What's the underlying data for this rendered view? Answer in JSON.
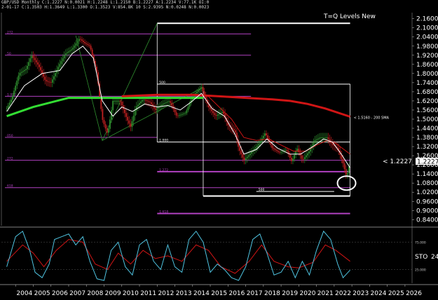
{
  "header": {
    "line1": "GBP/USD Monthly  C:1.2227  N:0.0021  H:1.2248  L:1.2150  B:1.2227  A:1.2234  V:77.1K  OI:0",
    "line2": "2-01-17  C:1.3503  H:1.3649  L:1.3300  O:1.3523  V:854.8K  10  S:2.9395  N:0.0248  N:0.0023"
  },
  "chart_data": [
    {
      "type": "line",
      "title": "T=Q Levels New",
      "x_ticks": [
        "2004",
        "2005",
        "2006",
        "2007",
        "2008",
        "2009",
        "2010",
        "2011",
        "2012",
        "2013",
        "2014",
        "2015",
        "2016",
        "2017",
        "2018",
        "2019",
        "2020",
        "2021",
        "2022",
        "2023",
        "2024",
        "2025",
        "2026"
      ],
      "y_ticks": [
        "2.1600",
        "2.1000",
        "2.0400",
        "1.9800",
        "1.9200",
        "1.8600",
        "1.8000",
        "1.7400",
        "1.6800",
        "1.6200",
        "1.5600",
        "1.5000",
        "1.4400",
        "1.3800",
        "1.3200",
        "1.2600",
        "1.2000",
        "1.1400",
        "1.0800",
        "1.0200",
        "0.9600",
        "0.9000",
        "0.8400"
      ],
      "ylim": [
        0.8,
        2.2
      ],
      "price_label": "1.2227",
      "price_marker": "< 1.2227",
      "price": 1.2227,
      "colors": {
        "up": "#2f8f2f",
        "down": "#c02020",
        "sma200": "#d01515",
        "sma40": "#33dd33",
        "fast": "#ffffff",
        "slow": "#d01515",
        "fib": "#b040c0",
        "level": "#ffffff"
      },
      "sma200_label": "< 1.5160 - 200 SMA",
      "levels": [
        {
          "y": 2.13,
          "x0": 2012.0,
          "x1": 2022.9,
          "label": "",
          "color": "#ffffff",
          "w": 2
        },
        {
          "y": 2.06,
          "x0": 2003.4,
          "x1": 2017.3,
          "label": "272",
          "color": "#b040c0",
          "w": 1
        },
        {
          "y": 1.92,
          "x0": 2003.4,
          "x1": 2017.3,
          "label": "50",
          "color": "#b040c0",
          "w": 1
        },
        {
          "y": 1.73,
          "x0": 2012.0,
          "x1": 2022.9,
          "label": "500",
          "color": "#ffffff",
          "w": 1
        },
        {
          "y": 1.65,
          "x0": 2003.4,
          "x1": 2017.3,
          "label": "1.000",
          "color": "#b040c0",
          "w": 1
        },
        {
          "y": 1.38,
          "x0": 2003.4,
          "x1": 2012.0,
          "label": "050",
          "color": "#b040c0",
          "w": 1
        },
        {
          "y": 1.35,
          "x0": 2012.0,
          "x1": 2022.9,
          "label": "1.000",
          "color": "#ffffff",
          "w": 1
        },
        {
          "y": 1.23,
          "x0": 2003.4,
          "x1": 2022.9,
          "label": "272",
          "color": "#b040c0",
          "w": 1
        },
        {
          "y": 1.155,
          "x0": 2012.0,
          "x1": 2022.9,
          "label": "1.272",
          "color": "#b040c0",
          "w": 2
        },
        {
          "y": 1.05,
          "x0": 2003.4,
          "x1": 2022.9,
          "label": "618",
          "color": "#b040c0",
          "w": 1
        },
        {
          "y": 1.025,
          "x0": 2017.6,
          "x1": 2022.0,
          "label": "500",
          "color": "#ffffff",
          "w": 1
        },
        {
          "y": 0.995,
          "x0": 2014.6,
          "x1": 2022.9,
          "label": "",
          "color": "#ffffff",
          "w": 2
        },
        {
          "y": 0.88,
          "x0": 2012.0,
          "x1": 2022.9,
          "label": "1.618",
          "color": "#b040c0",
          "w": 2
        }
      ],
      "close_path": [
        [
          2003.5,
          1.57
        ],
        [
          2003.8,
          1.64
        ],
        [
          2004.2,
          1.8
        ],
        [
          2004.6,
          1.83
        ],
        [
          2004.9,
          1.92
        ],
        [
          2005.3,
          1.85
        ],
        [
          2005.7,
          1.75
        ],
        [
          2006.0,
          1.74
        ],
        [
          2006.4,
          1.84
        ],
        [
          2006.8,
          1.93
        ],
        [
          2007.2,
          1.96
        ],
        [
          2007.6,
          2.03
        ],
        [
          2007.9,
          2.0
        ],
        [
          2008.2,
          1.98
        ],
        [
          2008.6,
          1.8
        ],
        [
          2008.9,
          1.5
        ],
        [
          2009.2,
          1.4
        ],
        [
          2009.5,
          1.62
        ],
        [
          2009.9,
          1.62
        ],
        [
          2010.3,
          1.5
        ],
        [
          2010.5,
          1.45
        ],
        [
          2010.8,
          1.58
        ],
        [
          2011.2,
          1.63
        ],
        [
          2011.6,
          1.61
        ],
        [
          2011.9,
          1.56
        ],
        [
          2012.3,
          1.6
        ],
        [
          2012.7,
          1.62
        ],
        [
          2013.1,
          1.52
        ],
        [
          2013.6,
          1.54
        ],
        [
          2014.0,
          1.65
        ],
        [
          2014.5,
          1.71
        ],
        [
          2014.9,
          1.58
        ],
        [
          2015.3,
          1.52
        ],
        [
          2015.7,
          1.55
        ],
        [
          2016.0,
          1.46
        ],
        [
          2016.4,
          1.42
        ],
        [
          2016.6,
          1.31
        ],
        [
          2016.9,
          1.23
        ],
        [
          2017.3,
          1.28
        ],
        [
          2017.7,
          1.33
        ],
        [
          2018.1,
          1.41
        ],
        [
          2018.5,
          1.31
        ],
        [
          2018.9,
          1.28
        ],
        [
          2019.3,
          1.3
        ],
        [
          2019.6,
          1.22
        ],
        [
          2019.9,
          1.31
        ],
        [
          2020.2,
          1.23
        ],
        [
          2020.6,
          1.29
        ],
        [
          2020.9,
          1.36
        ],
        [
          2021.2,
          1.38
        ],
        [
          2021.6,
          1.38
        ],
        [
          2021.9,
          1.33
        ],
        [
          2022.2,
          1.31
        ],
        [
          2022.5,
          1.21
        ],
        [
          2022.7,
          1.12
        ],
        [
          2022.9,
          1.22
        ]
      ],
      "sma40_path": [
        [
          2003.5,
          1.52
        ],
        [
          2005.0,
          1.58
        ],
        [
          2007.0,
          1.64
        ],
        [
          2009.0,
          1.64
        ],
        [
          2011.0,
          1.64
        ],
        [
          2013.0,
          1.64
        ],
        [
          2014.6,
          1.64
        ]
      ],
      "sma200_path": [
        [
          2010.0,
          1.65
        ],
        [
          2012.0,
          1.66
        ],
        [
          2014.0,
          1.66
        ],
        [
          2015.5,
          1.65
        ],
        [
          2017.0,
          1.64
        ],
        [
          2018.5,
          1.63
        ],
        [
          2019.5,
          1.62
        ],
        [
          2020.5,
          1.6
        ],
        [
          2021.5,
          1.57
        ],
        [
          2022.9,
          1.516
        ]
      ],
      "fast_ma_path": [
        [
          2003.5,
          1.55
        ],
        [
          2004.5,
          1.72
        ],
        [
          2005.5,
          1.8
        ],
        [
          2006.5,
          1.82
        ],
        [
          2007.2,
          1.93
        ],
        [
          2007.8,
          1.98
        ],
        [
          2008.4,
          1.9
        ],
        [
          2008.9,
          1.62
        ],
        [
          2009.5,
          1.52
        ],
        [
          2010.0,
          1.58
        ],
        [
          2010.6,
          1.55
        ],
        [
          2011.3,
          1.6
        ],
        [
          2012.0,
          1.58
        ],
        [
          2012.6,
          1.59
        ],
        [
          2013.3,
          1.56
        ],
        [
          2014.0,
          1.62
        ],
        [
          2014.5,
          1.67
        ],
        [
          2015.1,
          1.57
        ],
        [
          2015.8,
          1.52
        ],
        [
          2016.4,
          1.4
        ],
        [
          2016.9,
          1.27
        ],
        [
          2017.6,
          1.3
        ],
        [
          2018.2,
          1.37
        ],
        [
          2018.8,
          1.31
        ],
        [
          2019.5,
          1.27
        ],
        [
          2020.1,
          1.27
        ],
        [
          2020.8,
          1.32
        ],
        [
          2021.4,
          1.37
        ],
        [
          2021.9,
          1.35
        ],
        [
          2022.4,
          1.27
        ],
        [
          2022.9,
          1.18
        ]
      ],
      "slow_ma_path": [
        [
          2014.8,
          1.66
        ],
        [
          2015.5,
          1.58
        ],
        [
          2016.2,
          1.5
        ],
        [
          2016.9,
          1.38
        ],
        [
          2017.6,
          1.36
        ],
        [
          2018.3,
          1.37
        ],
        [
          2019.0,
          1.33
        ],
        [
          2019.7,
          1.29
        ],
        [
          2020.4,
          1.29
        ],
        [
          2021.0,
          1.33
        ],
        [
          2021.6,
          1.36
        ],
        [
          2022.1,
          1.34
        ],
        [
          2022.9,
          1.27
        ]
      ]
    },
    {
      "type": "line",
      "title": "",
      "label": "STO",
      "label_value": "24",
      "level_labels": [
        "25.000",
        "75.000"
      ],
      "ylim": [
        0,
        100
      ],
      "levels": [
        25,
        75
      ],
      "k_path": [
        [
          2003.5,
          30
        ],
        [
          2004.0,
          85
        ],
        [
          2004.4,
          95
        ],
        [
          2004.8,
          60
        ],
        [
          2005.1,
          20
        ],
        [
          2005.5,
          10
        ],
        [
          2005.9,
          35
        ],
        [
          2006.2,
          80
        ],
        [
          2006.6,
          85
        ],
        [
          2007.0,
          90
        ],
        [
          2007.4,
          70
        ],
        [
          2007.8,
          85
        ],
        [
          2008.2,
          40
        ],
        [
          2008.6,
          8
        ],
        [
          2009.0,
          5
        ],
        [
          2009.4,
          60
        ],
        [
          2009.8,
          75
        ],
        [
          2010.2,
          30
        ],
        [
          2010.6,
          15
        ],
        [
          2011.0,
          70
        ],
        [
          2011.4,
          80
        ],
        [
          2011.8,
          40
        ],
        [
          2012.2,
          25
        ],
        [
          2012.6,
          70
        ],
        [
          2013.0,
          30
        ],
        [
          2013.4,
          20
        ],
        [
          2013.8,
          80
        ],
        [
          2014.2,
          95
        ],
        [
          2014.6,
          75
        ],
        [
          2015.0,
          20
        ],
        [
          2015.4,
          35
        ],
        [
          2015.8,
          25
        ],
        [
          2016.2,
          10
        ],
        [
          2016.6,
          5
        ],
        [
          2017.0,
          30
        ],
        [
          2017.4,
          80
        ],
        [
          2017.8,
          90
        ],
        [
          2018.2,
          55
        ],
        [
          2018.6,
          15
        ],
        [
          2019.0,
          20
        ],
        [
          2019.4,
          40
        ],
        [
          2019.8,
          10
        ],
        [
          2020.2,
          40
        ],
        [
          2020.6,
          15
        ],
        [
          2021.0,
          60
        ],
        [
          2021.4,
          95
        ],
        [
          2021.8,
          80
        ],
        [
          2022.2,
          35
        ],
        [
          2022.5,
          10
        ],
        [
          2022.9,
          24
        ]
      ],
      "d_path": [
        [
          2003.5,
          40
        ],
        [
          2004.4,
          70
        ],
        [
          2005.0,
          55
        ],
        [
          2005.6,
          30
        ],
        [
          2006.3,
          60
        ],
        [
          2007.0,
          80
        ],
        [
          2007.8,
          75
        ],
        [
          2008.5,
          35
        ],
        [
          2009.2,
          25
        ],
        [
          2009.8,
          55
        ],
        [
          2010.5,
          35
        ],
        [
          2011.2,
          60
        ],
        [
          2011.9,
          45
        ],
        [
          2012.6,
          50
        ],
        [
          2013.4,
          40
        ],
        [
          2014.2,
          70
        ],
        [
          2014.9,
          60
        ],
        [
          2015.6,
          30
        ],
        [
          2016.4,
          18
        ],
        [
          2017.2,
          40
        ],
        [
          2017.9,
          70
        ],
        [
          2018.6,
          40
        ],
        [
          2019.4,
          30
        ],
        [
          2020.0,
          28
        ],
        [
          2020.8,
          38
        ],
        [
          2021.5,
          70
        ],
        [
          2022.1,
          60
        ],
        [
          2022.9,
          40
        ]
      ]
    }
  ]
}
